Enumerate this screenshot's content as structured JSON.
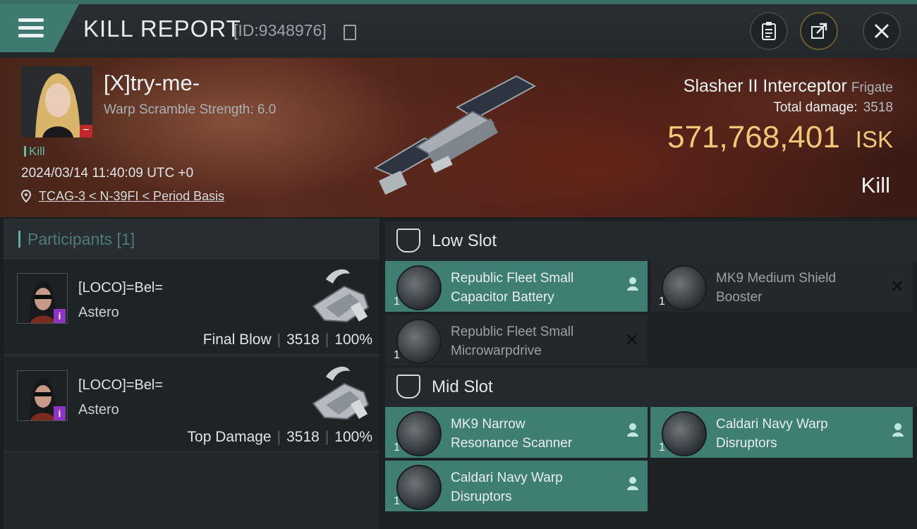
{
  "header": {
    "title": "KILL REPORT",
    "report_id": "[ID:9348976]",
    "buttons": [
      "clipboard-icon",
      "share-icon",
      "close-icon"
    ]
  },
  "victim": {
    "name": "[X]try-me-",
    "scramble": "Warp Scramble Strength: 6.0",
    "kill_tag": "Kill",
    "datetime": "2024/03/14 11:40:09 UTC +0",
    "location": "TCAG-3 < N-39FI < Period Basis",
    "ship_name": "Slasher II Interceptor",
    "ship_class": "Frigate",
    "total_damage_label": "Total damage:",
    "total_damage": "3518",
    "isk_value": "571,768,401",
    "isk_unit": "ISK",
    "result": "Kill"
  },
  "participants": {
    "title": "Participants [1]",
    "rows": [
      {
        "name": "[LOCO]=Bel=",
        "ship": "Astero",
        "role": "Final Blow",
        "damage": "3518",
        "percent": "100%"
      },
      {
        "name": "[LOCO]=Bel=",
        "ship": "Astero",
        "role": "Top Damage",
        "damage": "3518",
        "percent": "100%"
      }
    ]
  },
  "slots": {
    "low_title": "Low Slot",
    "mid_title": "Mid Slot",
    "low": [
      {
        "line1": "Republic Fleet Small",
        "line2": "Capacitor Battery",
        "qty": "1",
        "state": "active"
      },
      {
        "line1": "MK9 Medium Shield",
        "line2": "Booster",
        "qty": "1",
        "state": "destroyed"
      },
      {
        "line1": "Republic Fleet Small",
        "line2": "Microwarpdrive",
        "qty": "1",
        "state": "destroyed"
      }
    ],
    "mid": [
      {
        "line1": "MK9 Narrow",
        "line2": "Resonance Scanner",
        "qty": "1",
        "state": "active"
      },
      {
        "line1": "Caldari Navy Warp",
        "line2": "Disruptors",
        "qty": "1",
        "state": "active"
      },
      {
        "line1": "Caldari Navy Warp",
        "line2": "Disruptors",
        "qty": "1",
        "state": "active"
      }
    ]
  },
  "colors": {
    "accent": "#3f7f73",
    "isk": "#f2c77a",
    "badge": "#8e34c4",
    "minus": "#c1272d"
  }
}
